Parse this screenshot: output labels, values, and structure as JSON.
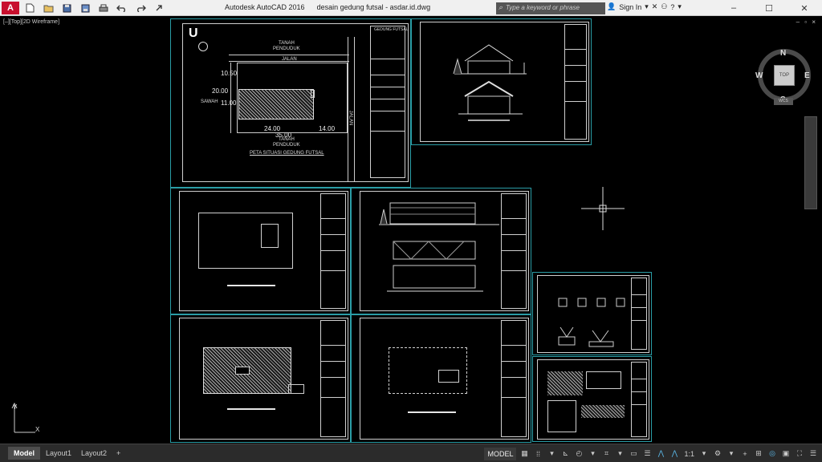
{
  "window": {
    "app_name": "Autodesk AutoCAD 2016",
    "file_name": "desain gedung futsal - asdar.id.dwg",
    "search_placeholder": "Type a keyword or phrase",
    "sign_in": "Sign In",
    "help": "?"
  },
  "icons": {
    "app_logo": "A",
    "new": "new-icon",
    "open": "open-icon",
    "save": "save-icon",
    "saveas": "saveas-icon",
    "print": "print-icon",
    "undo": "undo-icon",
    "redo": "redo-icon",
    "share": "share-icon"
  },
  "viewport": {
    "label": "[–][Top][2D Wireframe]",
    "controls": "– ▫ ×",
    "viewcube_face": "TOP",
    "viewcube_n": "N",
    "viewcube_s": "S",
    "viewcube_e": "E",
    "viewcube_w": "W",
    "wcs_label": "WCS",
    "ucs_x": "X",
    "ucs_y": "Y"
  },
  "drawing": {
    "north_symbol": "U",
    "site_labels": {
      "tanah_top": "TANAH",
      "penduduk_top": "PENDUDUK",
      "jalan_top": "JALAN",
      "tanah_bottom": "TANAH",
      "penduduk_bottom": "PENDUDUK",
      "jalan_right": "JALAN",
      "sawah": "SAWAH",
      "caption": "PETA SITUASI GEDUNG FUTSAL",
      "title_block": "GEDUNG FUTSAL"
    },
    "dimensions": {
      "d1": "10.50",
      "d2": "20.00",
      "d3": "11.00",
      "d4": "24.00",
      "d5": "14.00",
      "d6": "35.00"
    }
  },
  "layout_tabs": [
    {
      "label": "Model",
      "active": true
    },
    {
      "label": "Layout1",
      "active": false
    },
    {
      "label": "Layout2",
      "active": false
    }
  ],
  "add_tab": "+",
  "status": {
    "model_label": "MODEL",
    "grid": "grid-icon",
    "snap": "snap-icon",
    "scale": "1:1",
    "colors": {
      "accent": "#5bb8e8",
      "sheet_border": "#2a9da6",
      "title_bg": "#f0f0f0"
    }
  }
}
